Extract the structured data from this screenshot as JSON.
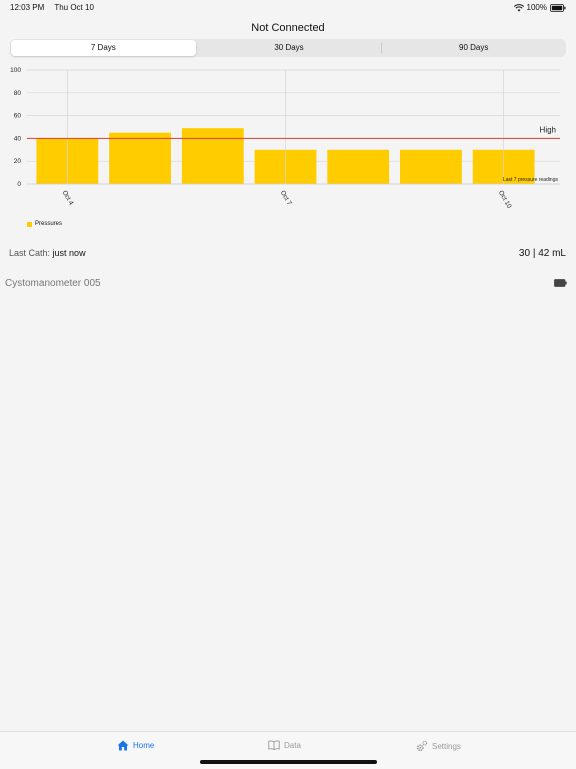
{
  "status": {
    "time": "12:03 PM",
    "date": "Thu Oct 10",
    "battery": "100%"
  },
  "title": "Not Connected",
  "segments": [
    "7 Days",
    "30 Days",
    "90 Days"
  ],
  "chart_data": {
    "type": "bar",
    "categories": [
      "Oct 4",
      "",
      "",
      "Oct 7",
      "",
      "",
      "Oct 10"
    ],
    "values": [
      40,
      45,
      49,
      30,
      30,
      30,
      30
    ],
    "yticks": [
      0,
      20,
      40,
      60,
      80,
      100
    ],
    "ylim": [
      0,
      100
    ],
    "threshold": {
      "value": 40,
      "label": "High",
      "color": "#e53935"
    },
    "annotation": "Last 7 pressure readings",
    "legend": "Pressures",
    "bar_color": "#ffcc00",
    "grid": true
  },
  "last_cath": {
    "label": "Last Cath:",
    "value": "just now"
  },
  "volume": "30 | 42 mL",
  "device": "Cystomanometer 005",
  "tabs": [
    {
      "label": "Home",
      "icon": "house-icon"
    },
    {
      "label": "Data",
      "icon": "book-icon"
    },
    {
      "label": "Settings",
      "icon": "gear-icon"
    }
  ],
  "colors": {
    "accent": "#1a73e8",
    "bar": "#ffcc00",
    "threshold": "#e53935"
  }
}
